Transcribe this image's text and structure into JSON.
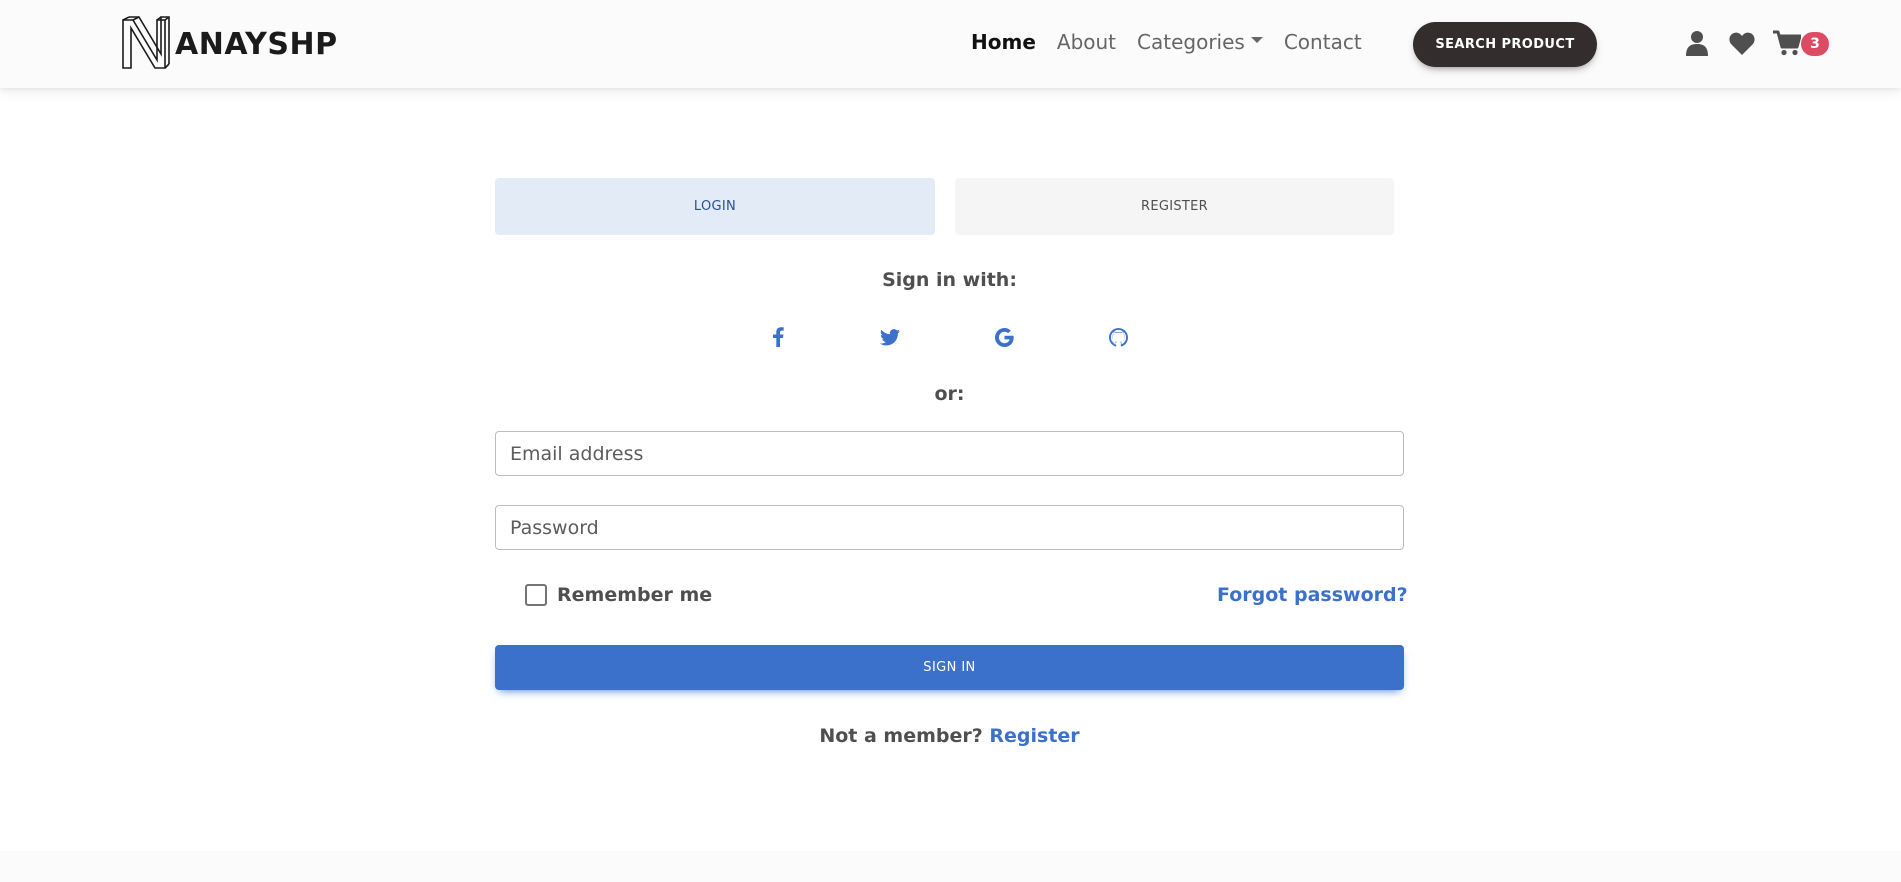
{
  "brand": {
    "name": "ANAYSHP",
    "logo_letter": "N"
  },
  "nav": {
    "links": [
      {
        "label": "Home",
        "active": true
      },
      {
        "label": "About"
      },
      {
        "label": "Categories"
      },
      {
        "label": "Contact"
      }
    ],
    "search_button": "SEARCH PRODUCT",
    "icons": [
      "user-icon",
      "heart-icon",
      "cart-icon"
    ],
    "cart_count": "3"
  },
  "tabs": {
    "login": "LOGIN",
    "register": "REGISTER"
  },
  "social": {
    "heading": "Sign in with:",
    "icons": [
      "facebook-icon",
      "twitter-icon",
      "google-icon",
      "github-icon"
    ]
  },
  "divider": "or:",
  "form": {
    "email_placeholder": "Email address",
    "password_placeholder": "Password",
    "remember_label": "Remember me",
    "remember_checked": false,
    "forgot_label": "Forgot password?",
    "submit_label": "SIGN IN"
  },
  "footer_prompt": {
    "text": "Not a member?",
    "link": "Register"
  },
  "colors": {
    "primary": "#3b71ca",
    "dark": "#332d2d",
    "badge": "#dc4c64",
    "tab_active_bg": "#e3ebf7"
  }
}
